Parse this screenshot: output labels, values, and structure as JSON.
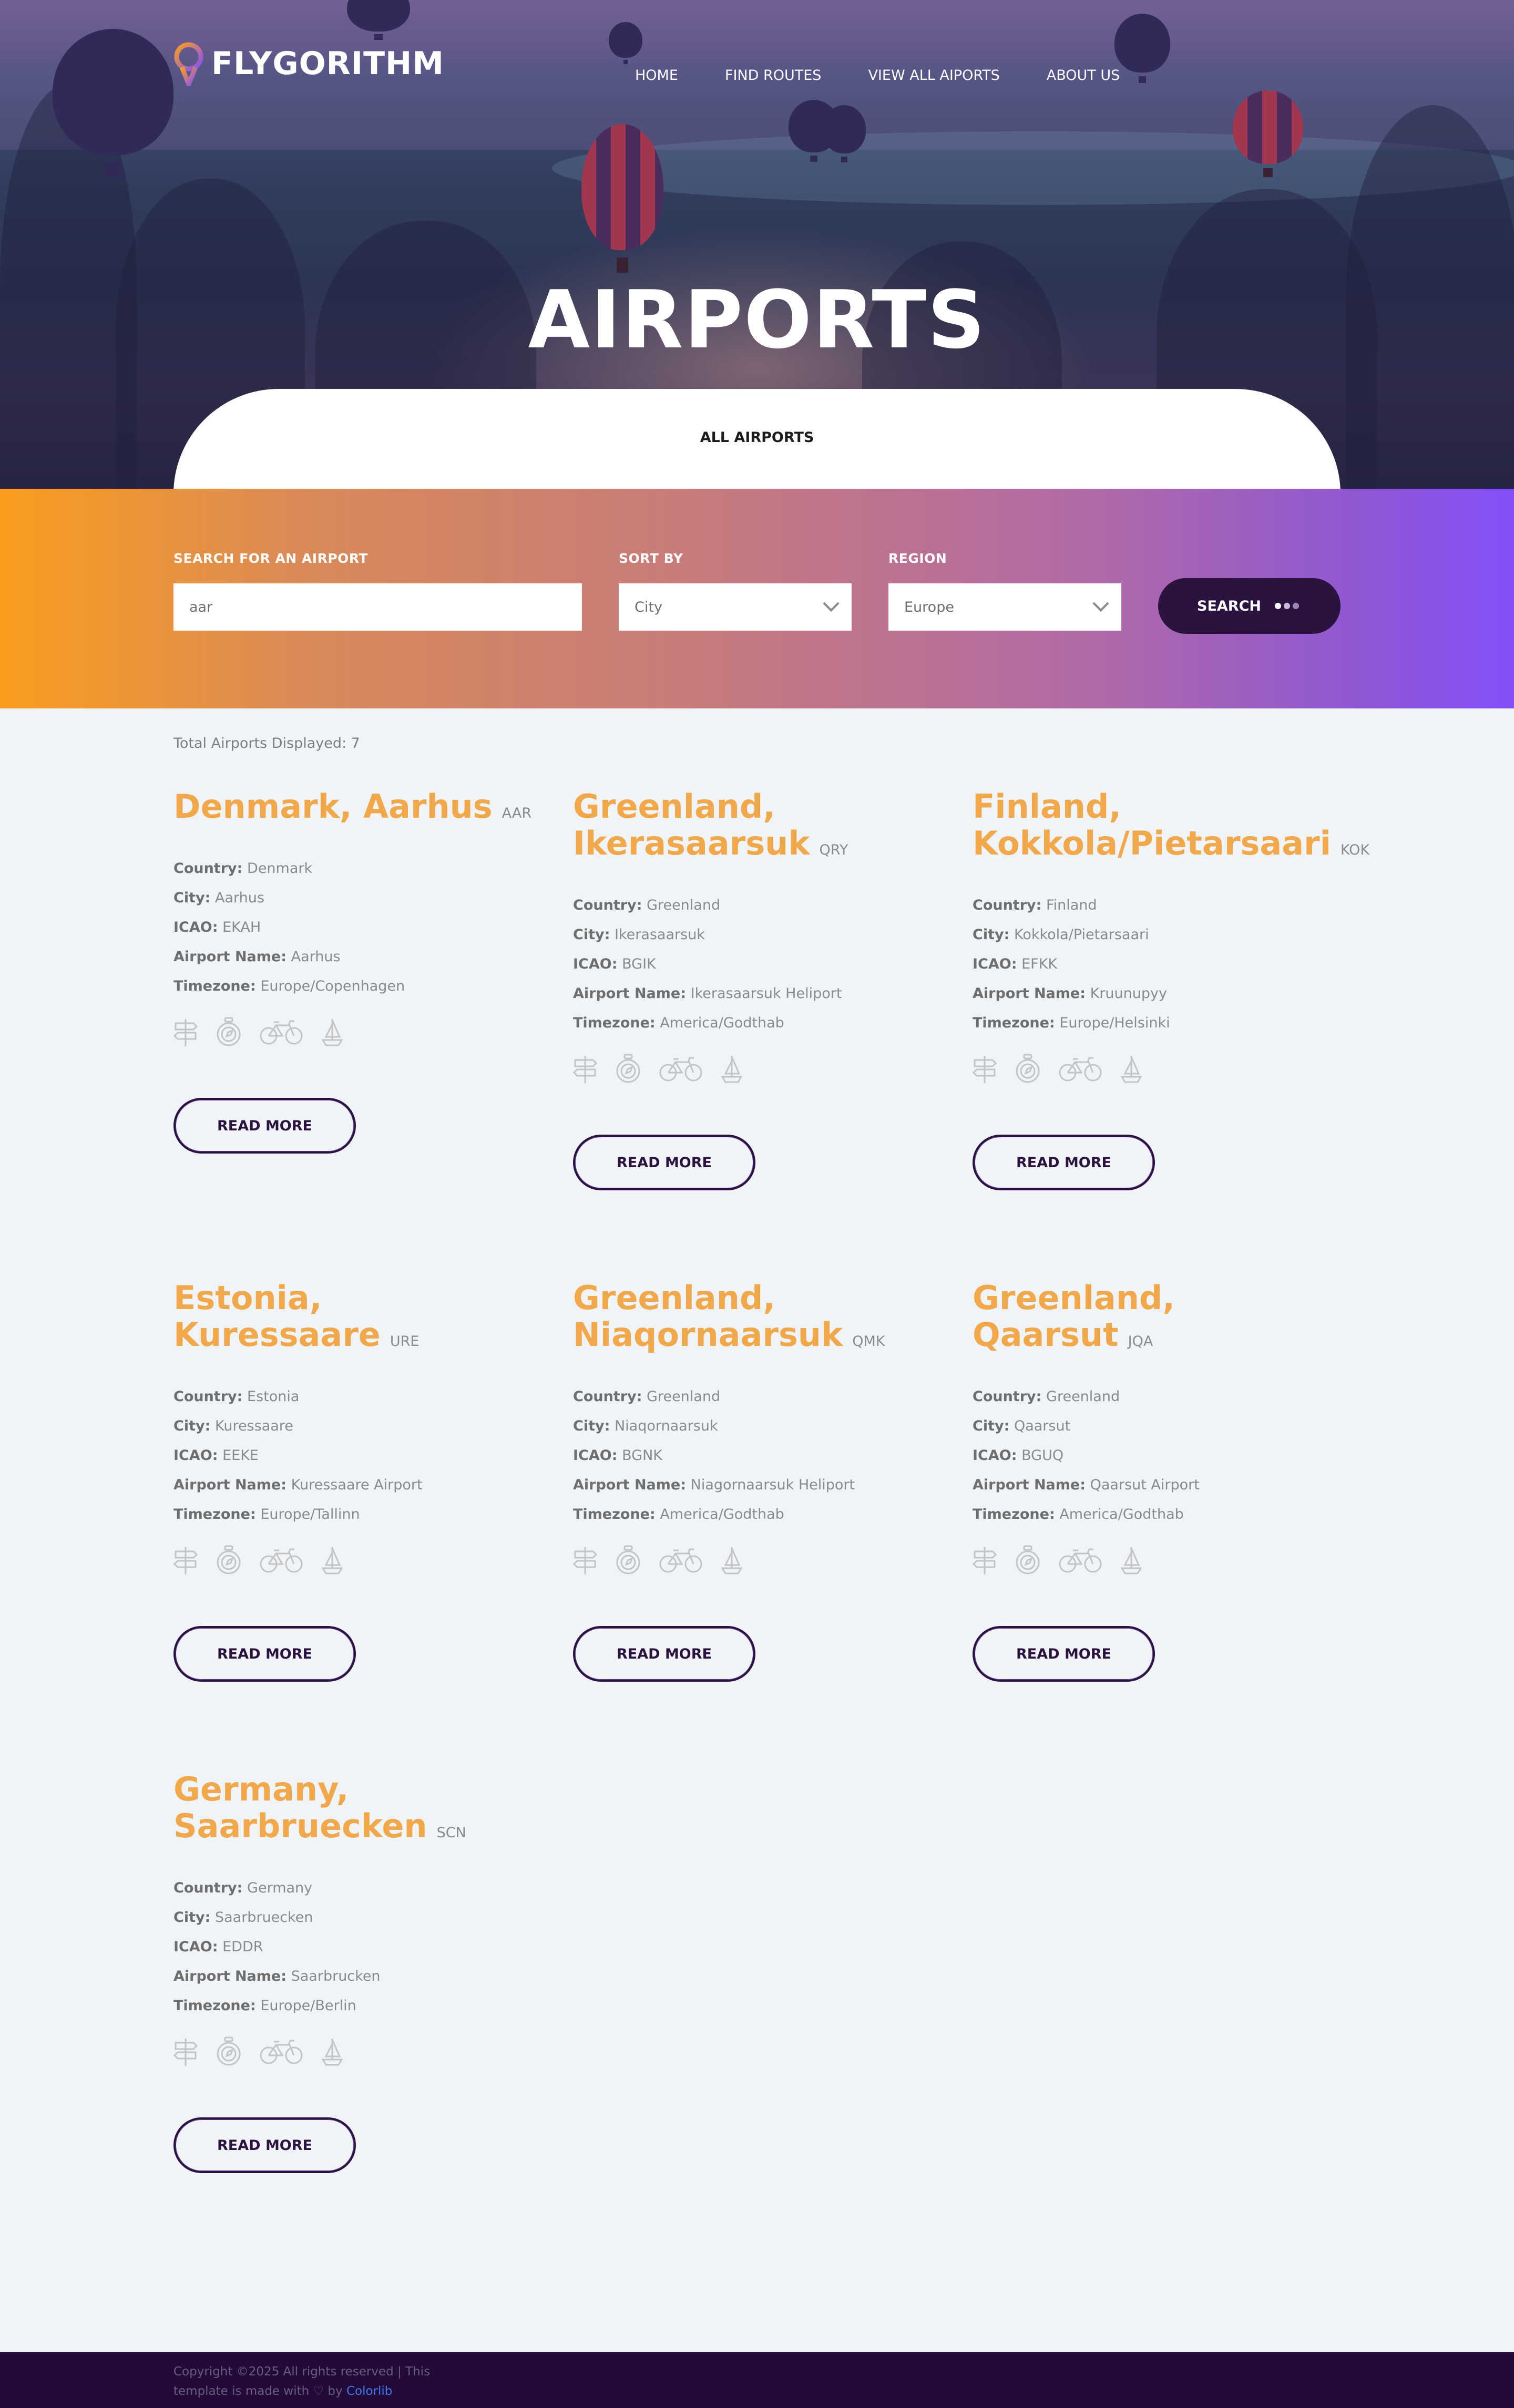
{
  "brand": {
    "name": "FLYGORITHM"
  },
  "nav": [
    {
      "label": "HOME"
    },
    {
      "label": "FIND ROUTES"
    },
    {
      "label": "VIEW ALL AIPORTS"
    },
    {
      "label": "ABOUT US"
    }
  ],
  "hero": {
    "title": "AIRPORTS",
    "tab_label": "ALL AIRPORTS"
  },
  "search": {
    "airport_label": "SEARCH FOR AN AIRPORT",
    "airport_value": "aar",
    "sort_label": "SORT BY",
    "sort_value": "City",
    "region_label": "REGION",
    "region_value": "Europe",
    "button_label": "SEARCH"
  },
  "results": {
    "total_text": "Total Airports Displayed: 7",
    "labels": {
      "country": "Country:",
      "city": "City:",
      "icao": "ICAO:",
      "airport_name": "Airport Name:",
      "timezone": "Timezone:"
    },
    "read_more": "READ MORE",
    "airports": [
      {
        "title": "Denmark, Aarhus",
        "code": "AAR",
        "country": "Denmark",
        "city": "Aarhus",
        "icao": "EKAH",
        "airport_name": "Aarhus",
        "timezone": "Europe/Copenhagen"
      },
      {
        "title": "Greenland, Ikerasaarsuk",
        "code": "QRY",
        "country": "Greenland",
        "city": "Ikerasaarsuk",
        "icao": "BGIK",
        "airport_name": "Ikerasaarsuk Heliport",
        "timezone": "America/Godthab"
      },
      {
        "title": "Finland, Kokkola/Pietarsaari",
        "code": "KOK",
        "country": "Finland",
        "city": "Kokkola/Pietarsaari",
        "icao": "EFKK",
        "airport_name": "Kruunupyy",
        "timezone": "Europe/Helsinki"
      },
      {
        "title": "Estonia, Kuressaare",
        "code": "URE",
        "country": "Estonia",
        "city": "Kuressaare",
        "icao": "EEKE",
        "airport_name": "Kuressaare Airport",
        "timezone": "Europe/Tallinn"
      },
      {
        "title": "Greenland, Niaqornaarsuk",
        "code": "QMK",
        "country": "Greenland",
        "city": "Niaqornaarsuk",
        "icao": "BGNK",
        "airport_name": "Niagornaarsuk Heliport",
        "timezone": "America/Godthab"
      },
      {
        "title": "Greenland, Qaarsut",
        "code": "JQA",
        "country": "Greenland",
        "city": "Qaarsut",
        "icao": "BGUQ",
        "airport_name": "Qaarsut Airport",
        "timezone": "America/Godthab"
      },
      {
        "title": "Germany, Saarbruecken",
        "code": "SCN",
        "country": "Germany",
        "city": "Saarbruecken",
        "icao": "EDDR",
        "airport_name": "Saarbrucken",
        "timezone": "Europe/Berlin"
      }
    ],
    "activity_icons": [
      "signpost-icon",
      "compass-icon",
      "bicycle-icon",
      "sailboat-icon"
    ]
  },
  "footer": {
    "text_before": "Copyright ©2025 All rights reserved | This template is made with ",
    "text_by": " by ",
    "brand": "Colorlib"
  },
  "colors": {
    "accent": "#f0a84a",
    "dark": "#2b1340",
    "footer_bg": "#220b3a",
    "link": "#3a7be6"
  }
}
